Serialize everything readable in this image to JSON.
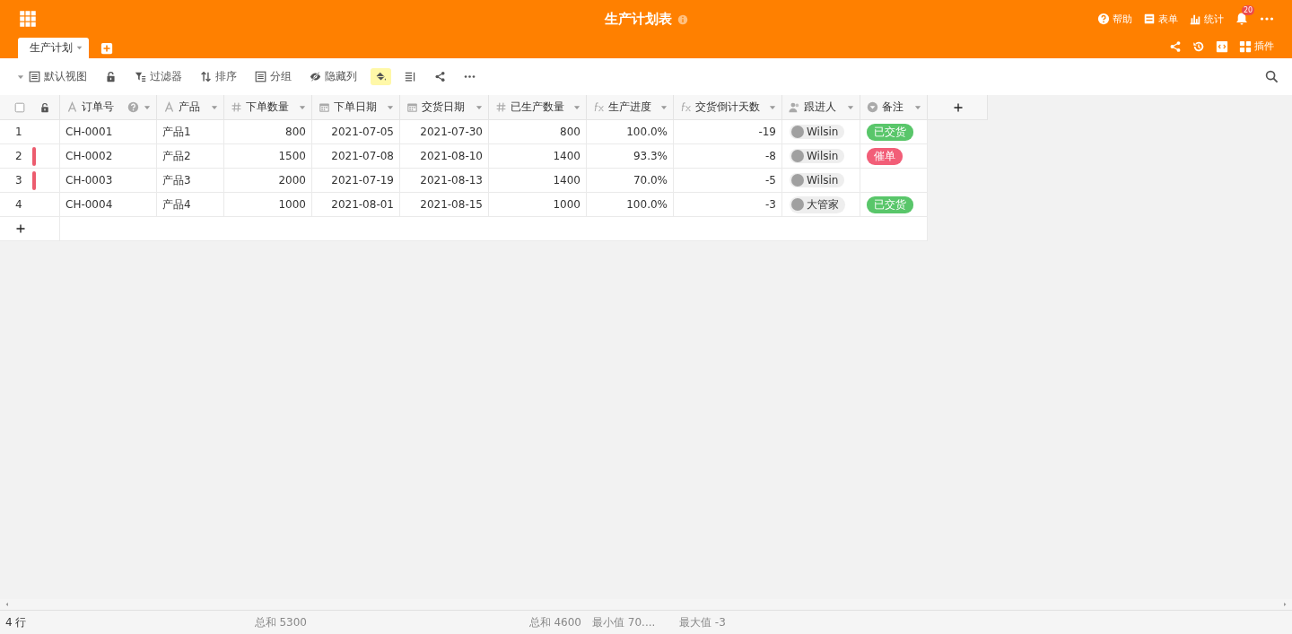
{
  "header": {
    "title": "生产计划表",
    "actions": [
      {
        "kind": "help",
        "label": "帮助"
      },
      {
        "kind": "form",
        "label": "表单"
      },
      {
        "kind": "stats",
        "label": "统计"
      }
    ],
    "notifications": {
      "badge": "20"
    },
    "tabs": [
      {
        "label": "生产计划",
        "selected": true
      }
    ],
    "tools": [
      {
        "kind": "share"
      },
      {
        "kind": "history"
      },
      {
        "kind": "code"
      },
      {
        "kind": "plugins",
        "label": "插件"
      }
    ]
  },
  "toolbar": {
    "view": "默认视图",
    "items": [
      {
        "kind": "lock",
        "active": false
      },
      {
        "kind": "filter",
        "label": "过滤器",
        "active": false
      },
      {
        "kind": "sort",
        "label": "排序",
        "active": false
      },
      {
        "kind": "group",
        "label": "分组",
        "active": false
      },
      {
        "kind": "hide",
        "label": "隐藏列",
        "active": false
      },
      {
        "kind": "paint",
        "active": true
      },
      {
        "kind": "rowheight",
        "active": false
      },
      {
        "kind": "share",
        "active": false
      },
      {
        "kind": "more",
        "active": false
      }
    ]
  },
  "table": {
    "select_all": {
      "checked": false
    },
    "columns": [
      {
        "kind": "text",
        "label": "订单号",
        "help": true
      },
      {
        "kind": "text",
        "label": "产品",
        "help": false
      },
      {
        "kind": "number",
        "label": "下单数量",
        "help": false,
        "summary": "总和 5300"
      },
      {
        "kind": "date",
        "label": "下单日期",
        "help": false
      },
      {
        "kind": "date",
        "label": "交货日期",
        "help": false
      },
      {
        "kind": "number",
        "label": "已生产数量",
        "help": false,
        "summary": "总和 4600"
      },
      {
        "kind": "formula",
        "label": "生产进度",
        "help": false,
        "summary": "最小值 70...."
      },
      {
        "kind": "formula",
        "label": "交货倒计天数",
        "help": false,
        "summary": "最大值 -3"
      },
      {
        "kind": "person",
        "label": "跟进人",
        "help": false
      },
      {
        "kind": "select",
        "label": "备注",
        "help": false
      }
    ],
    "rows": [
      {
        "number": "1",
        "flagged": false,
        "cells": [
          "CH-0001",
          "产品1",
          "800",
          "2021-07-05",
          "2021-07-30",
          "800",
          "100.0%",
          "-19",
          {
            "name": "Wilsin"
          },
          {
            "text": "已交货",
            "color": "#59c66a"
          }
        ]
      },
      {
        "number": "2",
        "flagged": true,
        "cells": [
          "CH-0002",
          "产品2",
          "1500",
          "2021-07-08",
          "2021-08-10",
          "1400",
          "93.3%",
          "-8",
          {
            "name": "Wilsin"
          },
          {
            "text": "催单",
            "color": "#f25e78"
          }
        ]
      },
      {
        "number": "3",
        "flagged": true,
        "cells": [
          "CH-0003",
          "产品3",
          "2000",
          "2021-07-19",
          "2021-08-13",
          "1400",
          "70.0%",
          "-5",
          {
            "name": "Wilsin"
          },
          null
        ]
      },
      {
        "number": "4",
        "flagged": false,
        "cells": [
          "CH-0004",
          "产品4",
          "1000",
          "2021-08-01",
          "2021-08-15",
          "1000",
          "100.0%",
          "-3",
          {
            "name": "大管家"
          },
          {
            "text": "已交货",
            "color": "#59c66a"
          }
        ]
      }
    ]
  },
  "footer": {
    "row_count": "4 行"
  }
}
